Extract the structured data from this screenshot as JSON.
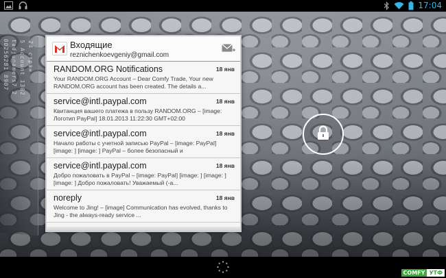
{
  "status_bar": {
    "left_icons": [
      "image-notification-icon",
      "headphones-icon"
    ],
    "right_icons": [
      "bluetooth-icon",
      "wifi-icon",
      "battery-icon"
    ],
    "time": "17:04"
  },
  "side_widget": {
    "columns": [
      "00256281 8907",
      "tadjunamers7 2",
      "5 Account 1302",
      "24 стран"
    ]
  },
  "gmail_widget": {
    "folder": "Входящие",
    "account": "reznichenkoevgeniy@gmail.com",
    "messages": [
      {
        "sender": "RANDOM.ORG Notifications",
        "date": "18 янв",
        "snippet": "Your RANDOM.ORG Account – Dear Comfy Trade, Your new RANDOM.ORG account has been created. The details a..."
      },
      {
        "sender": "service@intl.paypal.com",
        "date": "18 янв",
        "snippet": "Квитанция вашего платежа в пользу RANDOM.ORG – [image: Логотип PayPal] 18.01.2013 11:22:30 GMT+02:00"
      },
      {
        "sender": "service@intl.paypal.com",
        "date": "18 янв",
        "snippet": "Начало работы с учетной записью PayPal – [image: PayPal] [image: ] [image: ] PayPal – более безопасный и"
      },
      {
        "sender": "service@intl.paypal.com",
        "date": "18 янв",
        "snippet": "Добро пожаловать в PayPal – [image: PayPal] [image: ] [image: ] [image: ] Добро пожаловать! Уважаемый (-а..."
      },
      {
        "sender": "noreply",
        "date": "18 янв",
        "snippet": "Welcome to Jing! – [image] Communication has evolved, thanks to Jing - the always-ready service ..."
      }
    ]
  },
  "lock": {
    "icon": "lock-icon"
  },
  "bottom_bar": {
    "loading_icon": "loading-spinner-icon",
    "brand_part1": "COMFY",
    "brand_part2": "УТФ"
  },
  "colors": {
    "accent": "#33b5e5",
    "gmail_red": "#d93025",
    "brand_green": "#3aa935"
  }
}
